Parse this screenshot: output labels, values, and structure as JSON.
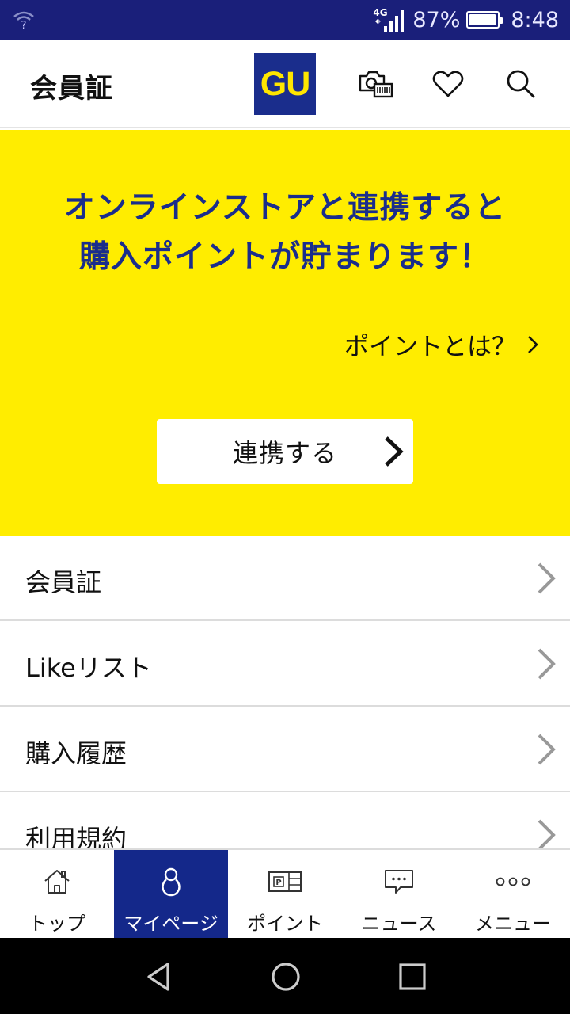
{
  "status_bar": {
    "network": "4G",
    "battery": "87%",
    "battery_level": 0.87,
    "time": "8:48",
    "icons": [
      "wifi-icon",
      "signal-icon",
      "battery-icon"
    ]
  },
  "header": {
    "title": "会員証",
    "logo": "GU",
    "icons": [
      "camera-barcode-icon",
      "heart-icon",
      "search-icon"
    ]
  },
  "banner": {
    "headline_line1": "オンラインストアと連携すると",
    "headline_line2": "購入ポイントが貯まります！",
    "point_link": "ポイントとは？",
    "connect_button": "連携する",
    "colors": {
      "background": "#ffed00",
      "headline": "#1a2d8c"
    }
  },
  "menu": [
    {
      "label": "会員証"
    },
    {
      "label": "Likeリスト"
    },
    {
      "label": "購入履歴"
    },
    {
      "label": "利用規約"
    }
  ],
  "tabs": [
    {
      "label": "トップ",
      "icon": "home-icon",
      "active": false
    },
    {
      "label": "マイページ",
      "icon": "person-icon",
      "active": true
    },
    {
      "label": "ポイント",
      "icon": "point-card-icon",
      "active": false
    },
    {
      "label": "ニュース",
      "icon": "chat-bubble-icon",
      "active": false
    },
    {
      "label": "メニュー",
      "icon": "more-dots-icon",
      "active": false
    }
  ],
  "nav": [
    "back-icon",
    "home-circle-icon",
    "recents-icon"
  ],
  "colors": {
    "brand_navy": "#1a2d8c",
    "brand_yellow": "#ffe600",
    "status_bar": "#1a1f7a"
  }
}
